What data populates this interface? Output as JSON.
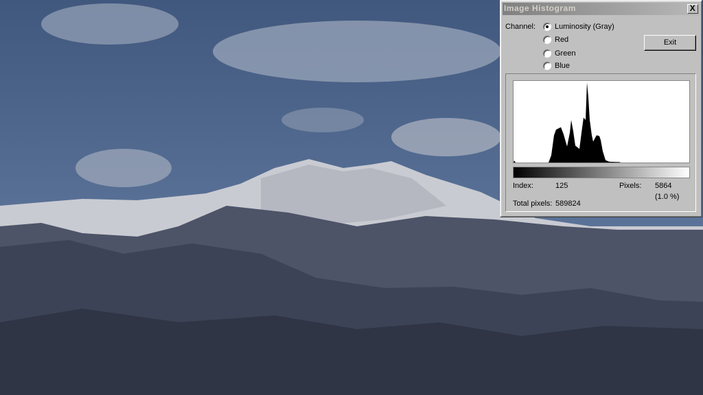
{
  "window": {
    "title": "Image Histogram",
    "close_label": "X"
  },
  "channel": {
    "label": "Channel:",
    "options": [
      "Luminosity (Gray)",
      "Red",
      "Green",
      "Blue"
    ],
    "selected": 0
  },
  "exit_label": "Exit",
  "info": {
    "index_label": "Index:",
    "index_value": "125",
    "pixels_label": "Pixels:",
    "pixels_value": "5864",
    "percent": "(1.0 %)",
    "total_label": "Total pixels:",
    "total_value": "589824"
  },
  "chart_data": {
    "type": "area",
    "title": "Luminosity histogram",
    "xlim": [
      0,
      255
    ],
    "ylim": [
      0,
      1
    ],
    "points": [
      [
        0,
        0
      ],
      [
        1,
        0.025
      ],
      [
        3,
        0
      ],
      [
        51,
        0
      ],
      [
        55,
        0.09
      ],
      [
        59,
        0.34
      ],
      [
        62,
        0.41
      ],
      [
        69,
        0.44
      ],
      [
        73,
        0.35
      ],
      [
        78,
        0.2
      ],
      [
        82,
        0.37
      ],
      [
        84,
        0.53
      ],
      [
        87,
        0.39
      ],
      [
        90,
        0.21
      ],
      [
        96,
        0.17
      ],
      [
        99,
        0.37
      ],
      [
        102,
        0.56
      ],
      [
        105,
        0.53
      ],
      [
        106,
        0.76
      ],
      [
        107,
        1.0
      ],
      [
        109,
        0.81
      ],
      [
        111,
        0.53
      ],
      [
        114,
        0.34
      ],
      [
        116,
        0.26
      ],
      [
        119,
        0.31
      ],
      [
        121,
        0.34
      ],
      [
        125,
        0.33
      ],
      [
        127,
        0.28
      ],
      [
        130,
        0.14
      ],
      [
        134,
        0.03
      ],
      [
        139,
        0.01
      ],
      [
        155,
        0.005
      ],
      [
        156,
        0
      ],
      [
        255,
        0
      ]
    ]
  }
}
